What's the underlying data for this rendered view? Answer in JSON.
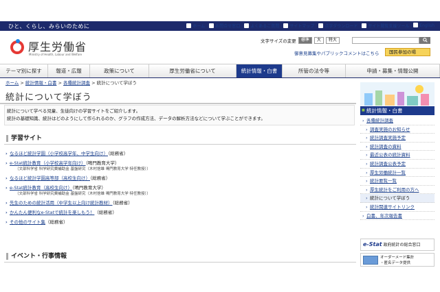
{
  "topbar": {
    "tagline": "ひと、くらし、みらいのために",
    "links": [
      "ホーム",
      "お問合せ窓口",
      "よくあるご質問",
      "サイトマップ",
      "点字ダウンロード",
      "サイト閲覧支援ツール",
      "English"
    ]
  },
  "header": {
    "logo": "厚生労働省",
    "logo_sub": "Ministry of Health, Labour and Welfare",
    "font_size_label": "文字サイズの変更",
    "font_sizes": [
      "標準",
      "大",
      "特大"
    ],
    "opinion_text": "御意見募集やパブリックコメントはこちら",
    "join_label": "国民参加の場"
  },
  "nav": {
    "items": [
      "テーマ別に探す",
      "報道・広報",
      "政策について",
      "厚生労働省について",
      "統計情報・白書",
      "所管の法令等",
      "申請・募集・情報公開"
    ]
  },
  "breadcrumb": [
    "ホーム",
    "統計情報・白書",
    "各種統計調査",
    "統計について学ぼう"
  ],
  "page_title": "統計について学ぼう",
  "intro": {
    "line1": "統計について学べる児童、生徒向けの学習サイトをご紹介します。",
    "line2": "統計の基礎知識、統計はどのようにして作られるのか、グラフの作成方法、データの解析方法などについて学ぶことができます。"
  },
  "learning": {
    "heading": "学習サイト",
    "items": [
      {
        "link": "なるほど統計学園（小学校高学年、中学生向け）",
        "suffix": "（総務省）",
        "note": ""
      },
      {
        "link": "e-Stat統計教育（小学校高学年向け）",
        "suffix": "（鳴門教育大学）",
        "note": "（文部科学省 科学研究費補助金 基盤研究（木村捨雄 鳴門教育大学 特任教授））"
      },
      {
        "link": "なるほど統計学園高等部（高校生向け）",
        "suffix": "（総務省）",
        "note": ""
      },
      {
        "link": "e-Stat統計教育（高校生向け）",
        "suffix": "（鳴門教育大学）",
        "note": "（文部科学省 科学研究費補助金 基盤研究（木村捨雄 鳴門教育大学 特任教授））"
      },
      {
        "link": "先生のための統計活用（中学生以上向け統計教材）",
        "suffix": "（総務省）",
        "note": ""
      },
      {
        "link": "かんたん便利なe-Statで統計を楽しもう！",
        "suffix": "（総務省）",
        "note": ""
      },
      {
        "link": "その他のサイト集",
        "suffix": "（総務省）",
        "note": ""
      }
    ]
  },
  "events": {
    "heading": "イベント・行事情報"
  },
  "sidebar": {
    "heading": "統計情報・白書",
    "items": [
      {
        "label": "各種統計調査",
        "top": true,
        "active": false
      },
      {
        "label": "調査実施のお知らせ",
        "top": false,
        "active": false
      },
      {
        "label": "統計調査実施予定",
        "top": false,
        "active": false
      },
      {
        "label": "統計調査の資料",
        "top": false,
        "active": false
      },
      {
        "label": "最近公表の統計資料",
        "top": false,
        "active": false
      },
      {
        "label": "統計調査公表予定",
        "top": false,
        "active": false
      },
      {
        "label": "厚生労働統計一覧",
        "top": false,
        "active": false
      },
      {
        "label": "統計要覧一覧",
        "top": false,
        "active": false
      },
      {
        "label": "厚生統計をご利用の方へ",
        "top": false,
        "active": false
      },
      {
        "label": "統計について学ぼう",
        "top": false,
        "active": true
      },
      {
        "label": "統計関連サイトリンク",
        "top": false,
        "active": false
      },
      {
        "label": "白書、年次報告書",
        "top": true,
        "active": false
      }
    ],
    "estat_logo": "e-Stat",
    "estat_text": "政府統計の総合窓口",
    "order_text_1": "オーダーメード集計",
    "order_text_2": "・匿名データ提供"
  },
  "colors": {
    "navy": "#1d2a6b",
    "nav_active": "#1d3a8c",
    "join": "#f6d35a"
  }
}
